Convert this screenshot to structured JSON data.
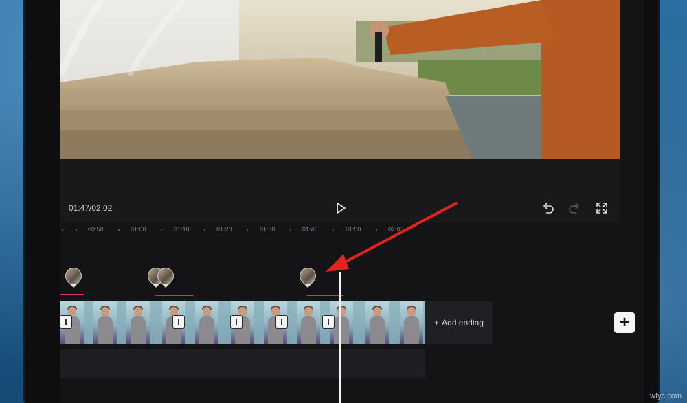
{
  "player": {
    "timecode": "01:47/02:02"
  },
  "ruler": {
    "ticks": [
      "00:50",
      "01:00",
      "01:10",
      "01:20",
      "01:30",
      "01:40",
      "01:50",
      "02:00"
    ]
  },
  "timeline": {
    "add_ending_label": "Add ending",
    "add_ending_icon": "+",
    "add_clip_icon": "+"
  },
  "annotation": {
    "arrow_color": "#e3231c"
  },
  "watermark": "wfyc.com"
}
